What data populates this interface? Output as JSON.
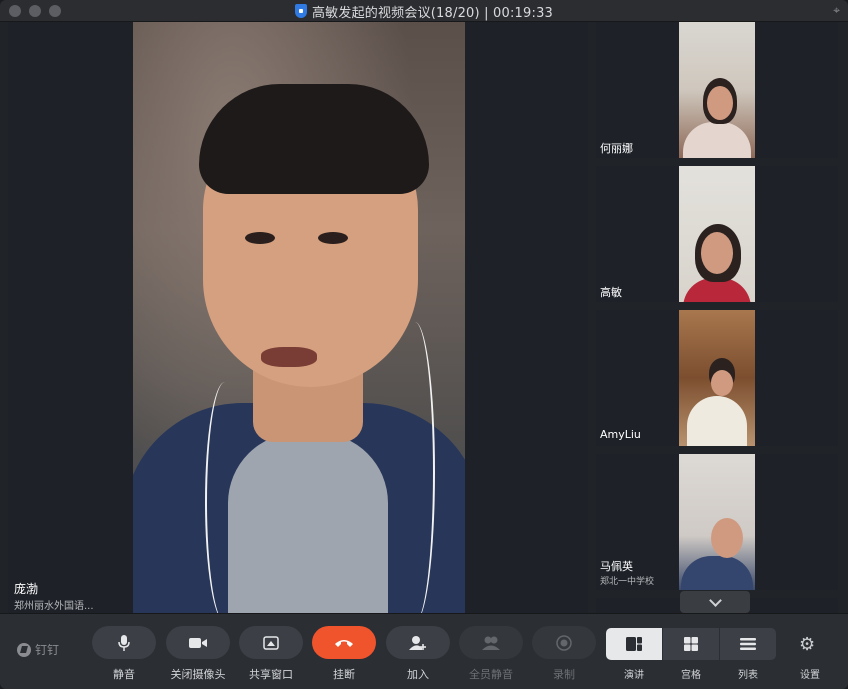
{
  "window": {
    "title": "高敏发起的视频会议(18/20) | 00:19:33"
  },
  "main_speaker": {
    "name": "庞渤",
    "org": "郑州丽水外国语..."
  },
  "participants": [
    {
      "name": "何丽娜",
      "org": ""
    },
    {
      "name": "高敏",
      "org": ""
    },
    {
      "name": "AmyLiu",
      "org": ""
    },
    {
      "name": "马佩英",
      "org": "郑北一中学校"
    }
  ],
  "toolbar": {
    "logo_text": "钉钉",
    "mute_label": "静音",
    "camera_label": "关闭摄像头",
    "share_label": "共享窗口",
    "hangup_label": "挂断",
    "join_label": "加入",
    "mute_all_label": "全员静音",
    "record_label": "录制",
    "view_speaker_label": "演讲",
    "view_grid_label": "宫格",
    "view_list_label": "列表",
    "settings_label": "设置"
  },
  "colors": {
    "hangup": "#f0542c",
    "background": "#202328",
    "toolbar": "#2b2e33",
    "active_view": "#e7e8ea"
  }
}
